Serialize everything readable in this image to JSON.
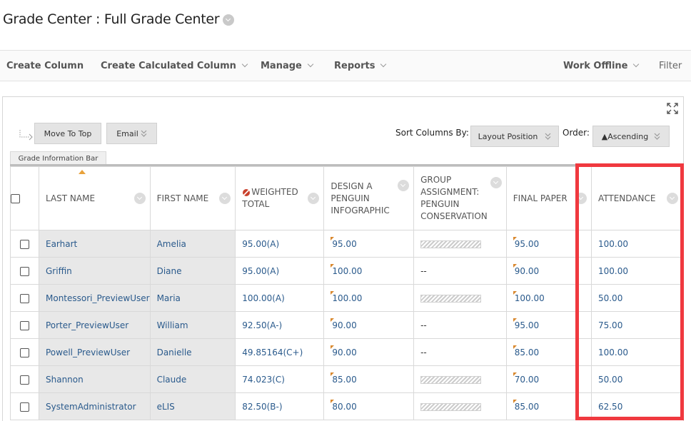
{
  "page": {
    "title": "Grade Center : Full Grade Center"
  },
  "toolbar": {
    "create_column": "Create Column",
    "create_calculated_column": "Create Calculated Column",
    "manage": "Manage",
    "reports": "Reports",
    "work_offline": "Work Offline",
    "filter": "Filter"
  },
  "actions": {
    "move_to_top": "Move To Top",
    "email": "Email",
    "sort_columns_by_label": "Sort Columns By:",
    "sort_columns_by_value": "Layout Position",
    "order_label": "Order:",
    "order_value": "▲Ascending"
  },
  "info_bar": {
    "label": "Grade Information Bar"
  },
  "table": {
    "headers": [
      "LAST NAME",
      "FIRST NAME",
      "WEIGHTED TOTAL",
      "DESIGN A PENGUIN INFOGRAPHIC",
      "GROUP ASSIGNMENT: PENGUIN CONSERVATION",
      "FINAL PAPER",
      "ATTENDANCE"
    ],
    "rows": [
      {
        "last": "Earhart",
        "first": "Amelia",
        "weighted": "95.00(A)",
        "design": "95.00",
        "group": "",
        "final": "95.00",
        "attendance": "100.00"
      },
      {
        "last": "Griffin",
        "first": "Diane",
        "weighted": "95.00(A)",
        "design": "100.00",
        "group": "--",
        "final": "90.00",
        "attendance": "100.00"
      },
      {
        "last": "Montessori_PreviewUser",
        "first": "Maria",
        "weighted": "100.00(A)",
        "design": "100.00",
        "group": "",
        "final": "100.00",
        "attendance": "50.00"
      },
      {
        "last": "Porter_PreviewUser",
        "first": "William",
        "weighted": "92.50(A-)",
        "design": "90.00",
        "group": "--",
        "final": "95.00",
        "attendance": "75.00"
      },
      {
        "last": "Powell_PreviewUser",
        "first": "Danielle",
        "weighted": "49.85164(C+)",
        "design": "90.00",
        "group": "--",
        "final": "85.00",
        "attendance": "100.00"
      },
      {
        "last": "Shannon",
        "first": "Claude",
        "weighted": "74.023(C)",
        "design": "85.00",
        "group": "",
        "final": "70.00",
        "attendance": "50.00"
      },
      {
        "last": "SystemAdministrator",
        "first": "eLIS",
        "weighted": "82.50(B-)",
        "design": "80.00",
        "group": "",
        "final": "85.00",
        "attendance": "62.50"
      }
    ]
  },
  "colors": {
    "highlight": "#f0393f",
    "link": "#2a5a8c",
    "flag": "#d9882e"
  }
}
